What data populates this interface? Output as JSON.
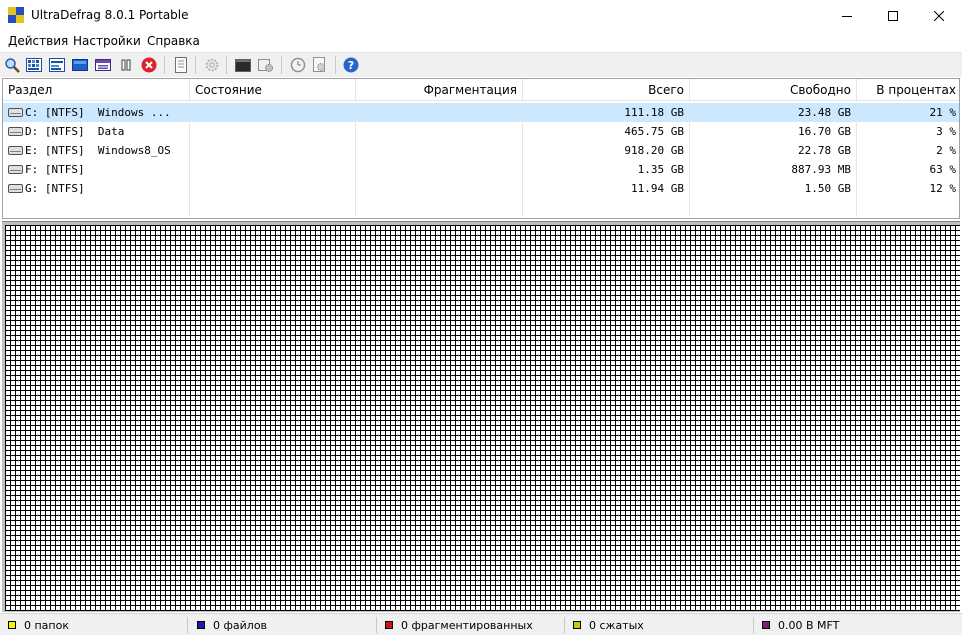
{
  "window": {
    "title": "UltraDefrag 8.0.1 Portable",
    "controls": {
      "minimize": "minimize-icon",
      "maximize": "maximize-icon",
      "close": "close-icon"
    }
  },
  "menu": {
    "items": [
      "Действия",
      "Настройки",
      "Справка"
    ]
  },
  "toolbar": {
    "icons": [
      "magnifier-icon",
      "defragment-icon",
      "quick-optimize-icon",
      "full-optimize-icon",
      "mft-optimize-icon",
      "pause-icon",
      "stop-icon",
      "report-icon",
      "settings-gear-icon",
      "boot-console-icon",
      "boot-script-icon",
      "scheduler-clock-icon",
      "job-config-icon",
      "help-icon"
    ]
  },
  "colors": {
    "selection": "#cce8ff",
    "stop": "#d9232d",
    "help": "#2866c8",
    "legend_folders": "#f4f400",
    "legend_files": "#1a1ab0",
    "legend_fragmented": "#c81414",
    "legend_compressed": "#c8c814",
    "legend_mft": "#7a1f78"
  },
  "volumes": {
    "columns": [
      "Раздел",
      "Состояние",
      "Фрагментация",
      "Всего",
      "Свободно",
      "В процентах"
    ],
    "rows": [
      {
        "name": "C: [NTFS]  Windows ...",
        "status": "",
        "fragmentation": "",
        "total": "111.18 GB",
        "free": "23.48 GB",
        "percent": "21 %",
        "selected": true
      },
      {
        "name": "D: [NTFS]  Data",
        "status": "",
        "fragmentation": "",
        "total": "465.75 GB",
        "free": "16.70 GB",
        "percent": "3 %",
        "selected": false
      },
      {
        "name": "E: [NTFS]  Windows8_OS",
        "status": "",
        "fragmentation": "",
        "total": "918.20 GB",
        "free": "22.78 GB",
        "percent": "2 %",
        "selected": false
      },
      {
        "name": "F: [NTFS]",
        "status": "",
        "fragmentation": "",
        "total": "1.35 GB",
        "free": "887.93 MB",
        "percent": "63 %",
        "selected": false
      },
      {
        "name": "G: [NTFS]",
        "status": "",
        "fragmentation": "",
        "total": "11.94 GB",
        "free": "1.50 GB",
        "percent": "12 %",
        "selected": false
      }
    ]
  },
  "status": {
    "folders": "0 папок",
    "files": "0 файлов",
    "fragmented": "0 фрагментированных",
    "compressed": "0 сжатых",
    "mft": "0.00 В MFT"
  }
}
